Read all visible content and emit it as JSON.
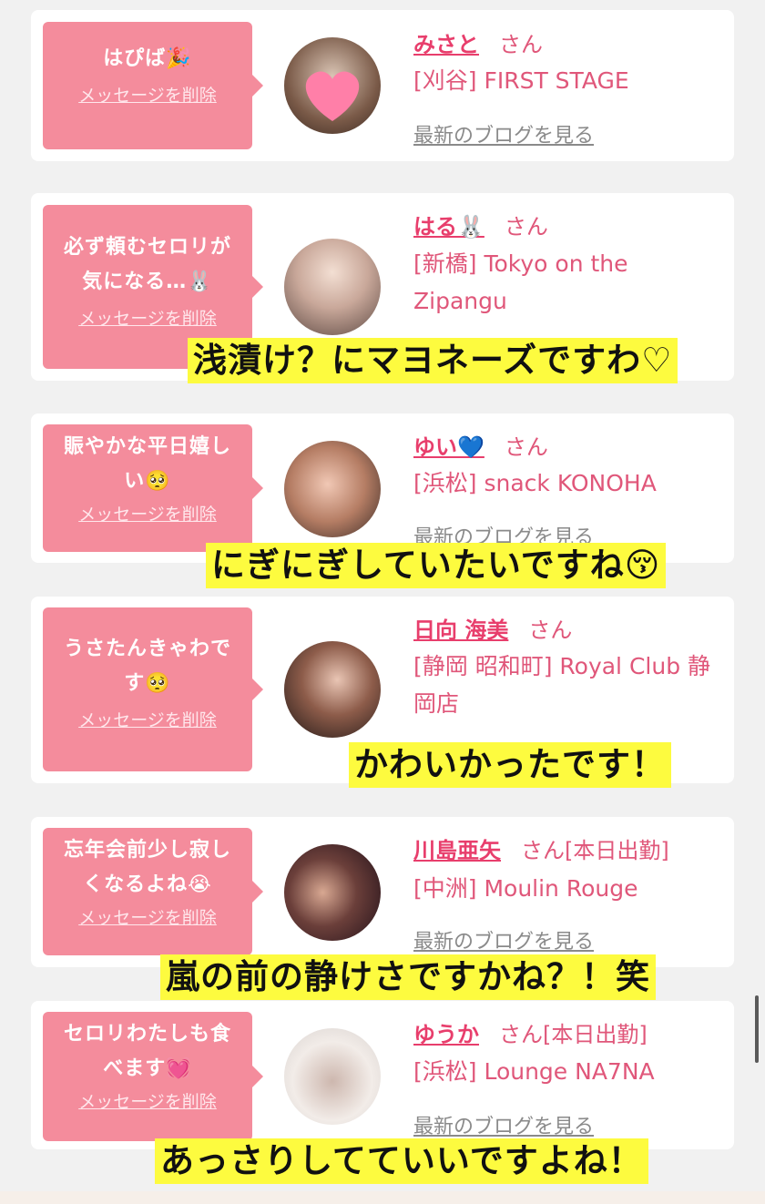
{
  "delete_label": "メッセージを削除",
  "san_label": "さん",
  "blog_label": "最新のブログを見る",
  "accent_color": "#f48c9c",
  "subtitle_color": "#fdfb3f",
  "posts": [
    {
      "message": "はぴば🎉",
      "name": "みさと",
      "suffix": "さん",
      "shop": "[刈谷] FIRST STAGE",
      "blog": "最新のブログを見る"
    },
    {
      "message": "必ず頼むセロリが気になる…🐰",
      "name": "はる🐰",
      "suffix": "さん",
      "shop": "[新橋] Tokyo on the Zipangu",
      "blog": ""
    },
    {
      "message": "賑やかな平日嬉しい🥺",
      "name": "ゆい💙",
      "suffix": "さん",
      "shop": "[浜松] snack KONOHA",
      "blog": "最新のブログを見る"
    },
    {
      "message": "うさたんきゃわです🥺",
      "name": "日向 海美",
      "suffix": "さん",
      "shop": "[静岡 昭和町] Royal Club 静岡店",
      "blog": ""
    },
    {
      "message": "忘年会前少し寂しくなるよね😭",
      "name": "川島亜矢",
      "suffix": "さん[本日出勤]",
      "shop": "[中洲] Moulin Rouge",
      "blog": "最新のブログを見る"
    },
    {
      "message": "セロリわたしも食べます💓",
      "name": "ゆうか",
      "suffix": "さん[本日出勤]",
      "shop": "[浜松] Lounge NA7NA",
      "blog": "最新のブログを見る"
    }
  ],
  "subtitles": [
    "浅漬け？にマヨネーズですわ♡",
    "にぎにぎしていたいですね😚",
    "かわいかったです！",
    "嵐の前の静けさですかね？！笑",
    "あっさりしてていいですよね！"
  ]
}
